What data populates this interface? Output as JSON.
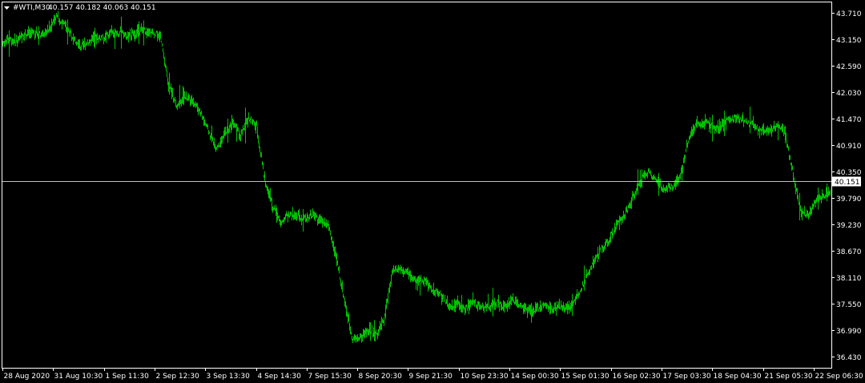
{
  "header": {
    "symbol_timeframe": "#WTI,M30",
    "ohlc": "40.157 40.182 40.063 40.151"
  },
  "colors": {
    "background": "#000000",
    "frame": "#ffffff",
    "bars": "#00c000",
    "current_price_line": "#c0c0c0",
    "text": "#ffffff"
  },
  "chart_data": {
    "type": "line",
    "symbol": "#WTI",
    "timeframe": "M30",
    "ylim": [
      36.2,
      43.95
    ],
    "y_ticks": [
      "43.710",
      "43.150",
      "42.590",
      "42.030",
      "41.470",
      "40.910",
      "40.350",
      "39.790",
      "39.230",
      "38.670",
      "38.110",
      "37.550",
      "36.990",
      "36.430"
    ],
    "x_ticks": [
      "28 Aug 2020",
      "31 Aug 10:30",
      "1 Sep 11:30",
      "2 Sep 12:30",
      "3 Sep 13:30",
      "4 Sep 14:30",
      "7 Sep 15:30",
      "8 Sep 20:30",
      "9 Sep 21:30",
      "10 Sep 23:30",
      "14 Sep 00:30",
      "15 Sep 01:30",
      "16 Sep 02:30",
      "17 Sep 03:30",
      "18 Sep 04:30",
      "21 Sep 05:30",
      "22 Sep 06:30"
    ],
    "current_price": 40.151,
    "current_price_label": "40.151",
    "grid": false,
    "legend": "none",
    "series": [
      {
        "x": [
          0,
          10,
          20,
          30,
          40,
          50,
          60,
          70,
          80,
          90,
          100,
          110,
          120,
          130,
          140,
          150,
          160,
          170,
          180,
          190,
          200,
          210,
          220,
          230,
          240,
          250,
          260,
          270,
          280,
          290,
          300,
          310,
          320,
          330,
          340,
          350,
          360,
          370,
          380,
          390,
          400,
          410,
          420,
          430,
          440,
          450,
          460,
          470,
          480,
          490,
          500,
          510,
          520,
          530,
          540,
          550,
          560,
          570,
          580,
          590,
          600,
          610,
          620,
          630,
          640,
          650,
          660,
          670,
          680,
          690,
          700,
          710,
          720,
          730,
          740,
          750,
          760,
          770,
          780,
          790,
          800,
          810,
          820,
          830,
          840,
          850,
          860,
          870,
          880,
          890,
          900,
          910,
          920,
          930,
          940,
          950,
          960,
          970,
          980,
          990,
          1000,
          1010,
          1020,
          1030,
          1036
        ],
        "values": [
          43.02,
          43.18,
          43.1,
          43.25,
          43.3,
          43.25,
          43.35,
          43.65,
          43.45,
          43.2,
          43.0,
          43.1,
          43.18,
          43.2,
          43.3,
          43.28,
          43.22,
          43.3,
          43.35,
          43.3,
          43.2,
          42.2,
          41.75,
          41.9,
          41.85,
          41.6,
          41.2,
          40.85,
          41.15,
          41.4,
          41.1,
          41.5,
          41.3,
          40.2,
          39.6,
          39.3,
          39.45,
          39.4,
          39.35,
          39.45,
          39.3,
          39.2,
          38.5,
          37.6,
          36.8,
          36.85,
          37.0,
          36.9,
          37.3,
          38.3,
          38.3,
          38.2,
          38.0,
          38.05,
          37.85,
          37.75,
          37.5,
          37.55,
          37.45,
          37.6,
          37.5,
          37.5,
          37.55,
          37.5,
          37.65,
          37.5,
          37.4,
          37.45,
          37.5,
          37.45,
          37.5,
          37.45,
          37.7,
          38.05,
          38.4,
          38.7,
          38.9,
          39.25,
          39.45,
          39.8,
          40.2,
          40.35,
          40.15,
          39.95,
          40.05,
          40.3,
          41.1,
          41.35,
          41.4,
          41.3,
          41.3,
          41.45,
          41.5,
          41.4,
          41.35,
          41.2,
          41.25,
          41.3,
          41.15,
          40.3,
          39.5,
          39.45,
          39.8,
          39.85,
          39.95
        ]
      }
    ]
  }
}
